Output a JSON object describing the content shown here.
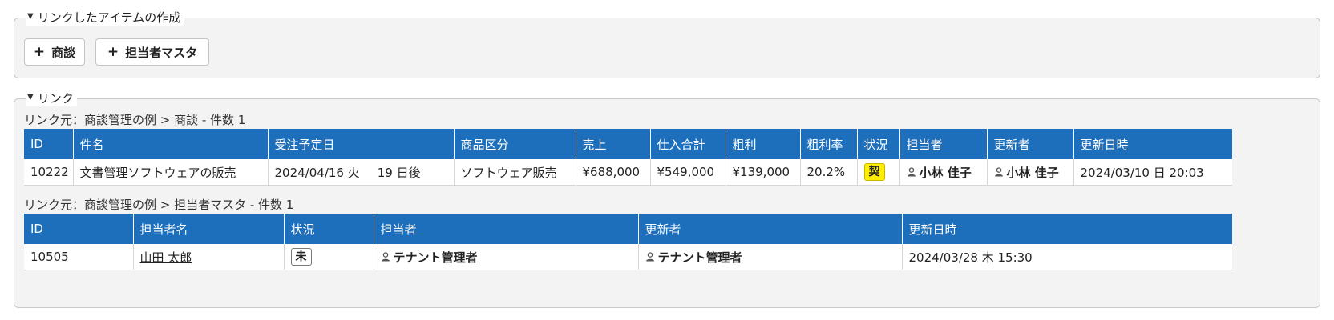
{
  "create_section": {
    "title": "リンクしたアイテムの作成",
    "buttons": [
      {
        "plus": "+",
        "label": "商談"
      },
      {
        "plus": "+",
        "label": "担当者マスタ"
      }
    ]
  },
  "link_section": {
    "title": "リンク",
    "tables": [
      {
        "caption": "リンク元：商談管理の例 > 商談 - 件数 1",
        "headers": [
          "ID",
          "件名",
          "受注予定日",
          "商品区分",
          "売上",
          "仕入合計",
          "粗利",
          "粗利率",
          "状況",
          "担当者",
          "更新者",
          "更新日時"
        ],
        "row": {
          "id": "10222",
          "subject": "文書管理ソフトウェアの販売",
          "due_date": "2024/04/16 火",
          "due_days": "19 日後",
          "category": "ソフトウェア販売",
          "sales": "¥688,000",
          "purchase_total": "¥549,000",
          "gross_profit": "¥139,000",
          "margin": "20.2%",
          "status": "契",
          "owner": "小林 佳子",
          "updater": "小林 佳子",
          "updated_at": "2024/03/10 日 20:03"
        }
      },
      {
        "caption": "リンク元：商談管理の例 > 担当者マスタ - 件数 1",
        "headers": [
          "ID",
          "担当者名",
          "状況",
          "担当者",
          "更新者",
          "更新日時"
        ],
        "row": {
          "id": "10505",
          "name": "山田 太郎",
          "status": "未",
          "owner": "テナント管理者",
          "updater": "テナント管理者",
          "updated_at": "2024/03/28 木 15:30"
        }
      }
    ]
  },
  "colors": {
    "header_bg": "#1d6fbc",
    "status_contract": "#ffee00"
  },
  "icons": {
    "section_toggle": "caret-down-icon",
    "user": "user-icon"
  }
}
